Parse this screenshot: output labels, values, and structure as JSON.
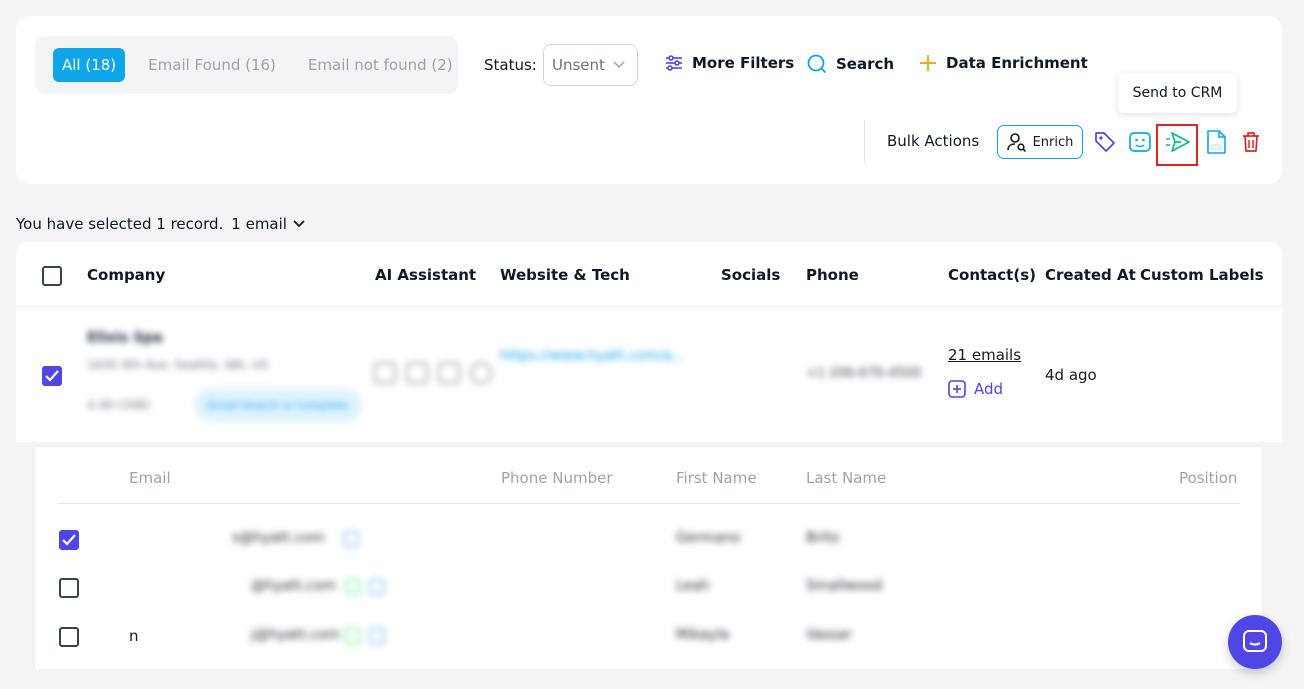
{
  "filter_tabs": [
    {
      "label": "All (18)"
    },
    {
      "label": "Email Found (16)"
    },
    {
      "label": "Email not found (2)"
    }
  ],
  "status": {
    "label": "Status:",
    "value": "Unsent"
  },
  "toolbar": {
    "more_filters": "More Filters",
    "search": "Search",
    "data_enrichment": "Data Enrichment"
  },
  "bulk": {
    "label": "Bulk Actions",
    "enrich": "Enrich",
    "tooltip": "Send to CRM"
  },
  "selection": {
    "text": "You have selected 1 record.",
    "emails": "1 email"
  },
  "table": {
    "headers": [
      "Company",
      "AI Assistant",
      "Website & Tech",
      "Socials",
      "Phone",
      "Contact(s)",
      "Created At",
      "Custom Labels"
    ],
    "row": {
      "company": "Elixis Spa",
      "address": "1635 9th Ave, Seattle, WA, US",
      "rating": "4.40 (348)",
      "badge": "Email Search is Complete",
      "website": "https://www.hyatt.com/a...",
      "phone": "+1 206-676-4500",
      "contacts_link": "21 emails",
      "add_label": "Add",
      "created_at": "4d ago"
    }
  },
  "subtable": {
    "headers": [
      "Email",
      "Phone Number",
      "First Name",
      "Last Name",
      "Position"
    ],
    "rows": [
      {
        "prefix": "",
        "email": "s@hyatt.com",
        "first": "Germano",
        "last": "Brito",
        "checked": true
      },
      {
        "prefix": "",
        "email": "@hyatt.com",
        "first": "Leah",
        "last": "Smallwood",
        "checked": false
      },
      {
        "prefix": "n",
        "email": "j@hyatt.com",
        "first": "Mikayla",
        "last": "Vassar",
        "checked": false
      }
    ]
  },
  "colors": {
    "accent": "#0ea5e9",
    "primary": "#4f46e5",
    "danger": "#dc2626"
  }
}
